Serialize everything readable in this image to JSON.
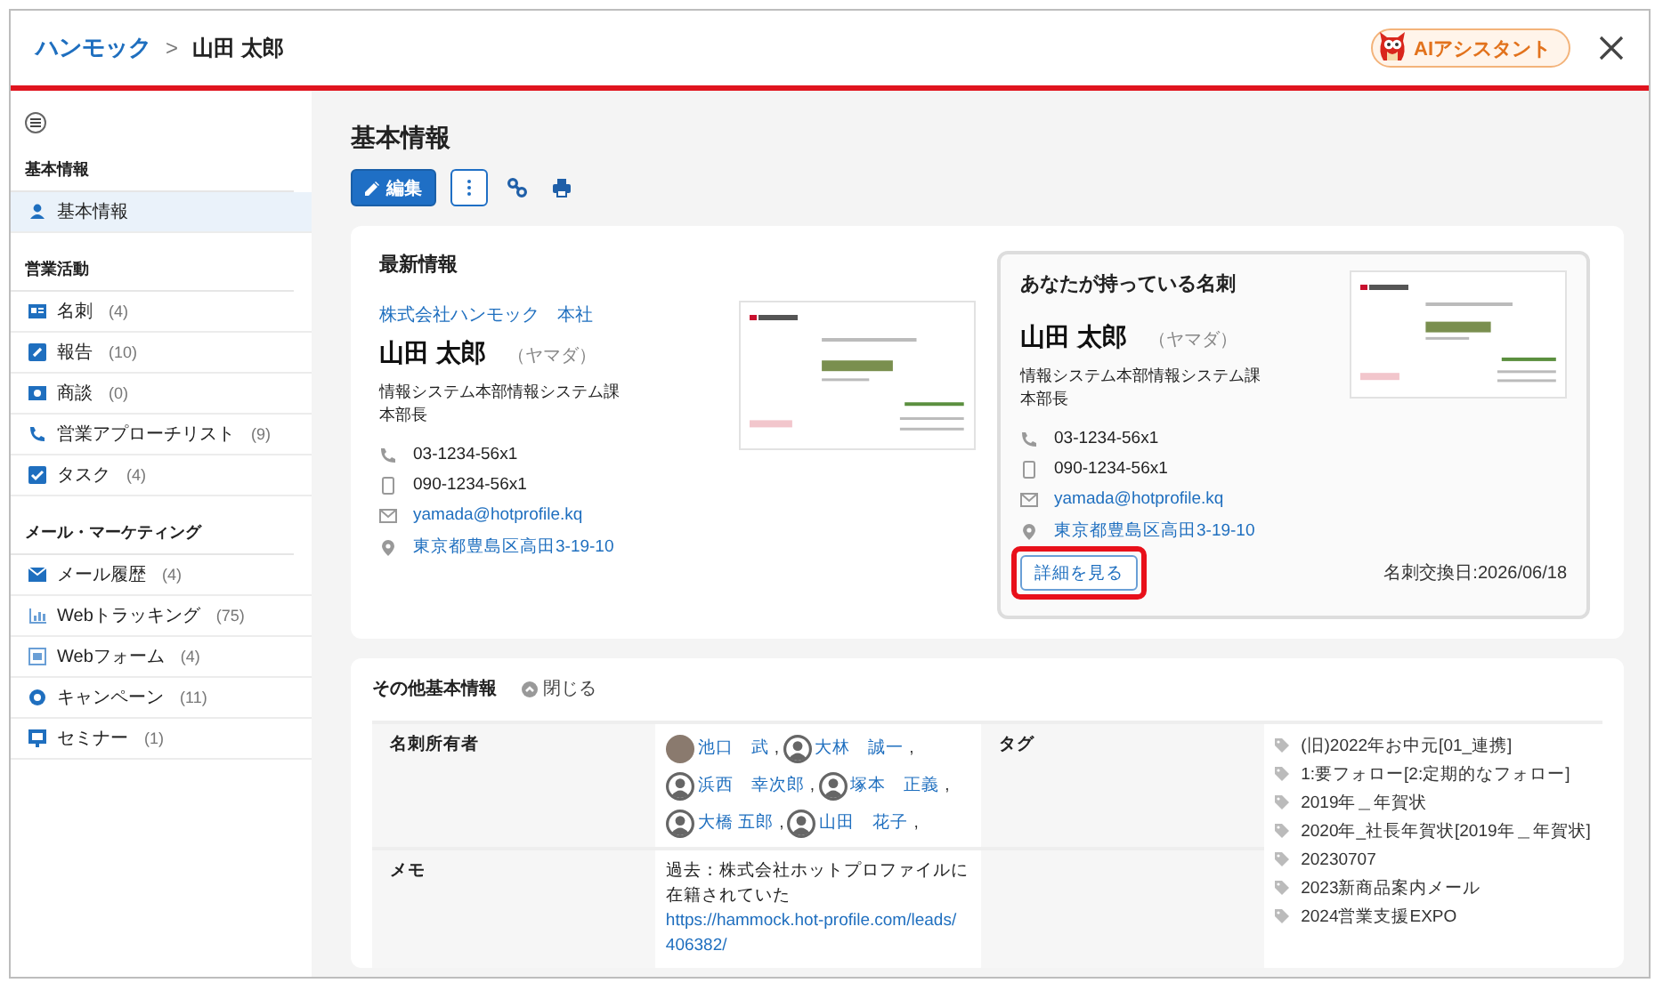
{
  "header": {
    "breadcrumb_parent": "ハンモック",
    "breadcrumb_separator": ">",
    "breadcrumb_current": "山田 太郎",
    "assistant_button": "AIアシスタント"
  },
  "sidebar": {
    "sections": [
      {
        "title": "基本情報",
        "items": [
          {
            "label": "基本情報",
            "selected": true
          }
        ]
      },
      {
        "title": "営業活動",
        "items": [
          {
            "label": "名刺",
            "count": "(4)",
            "selected": false
          },
          {
            "label": "報告",
            "count": "(10)",
            "selected": false
          },
          {
            "label": "商談",
            "count": "(0)",
            "selected": false
          },
          {
            "label": "営業アプローチリスト",
            "count": "(9)",
            "selected": false
          },
          {
            "label": "タスク",
            "count": "(4)",
            "selected": false
          }
        ]
      },
      {
        "title": "メール・マーケティング",
        "items": [
          {
            "label": "メール履歴",
            "count": "(4)",
            "selected": false
          },
          {
            "label": "Webトラッキング",
            "count": "(75)",
            "selected": false
          },
          {
            "label": "Webフォーム",
            "count": "(4)",
            "selected": false
          },
          {
            "label": "キャンペーン",
            "count": "(11)",
            "selected": false
          },
          {
            "label": "セミナー",
            "count": "(1)",
            "selected": false
          }
        ]
      }
    ]
  },
  "page_title": "基本情報",
  "toolbar": {
    "edit_button": "編集"
  },
  "latest": {
    "title": "最新情報",
    "company": "株式会社ハンモック　本社",
    "name": "山田 太郎",
    "reading": "（ヤマダ）",
    "department": "情報システム本部情報システム課",
    "position": "本部長",
    "phone": "03-1234-56x1",
    "mobile": "090-1234-56x1",
    "email": "yamada@hotprofile.kq",
    "address": "東京都豊島区高田3-19-10"
  },
  "owned_card": {
    "title": "あなたが持っている名刺",
    "name": "山田 太郎",
    "reading": "（ヤマダ）",
    "department": "情報システム本部情報システム課",
    "position": "本部長",
    "phone": "03-1234-56x1",
    "mobile": "090-1234-56x1",
    "email": "yamada@hotprofile.kq",
    "address": "東京都豊島区高田3-19-10",
    "details_button": "詳細を見る",
    "details_highlighted": true,
    "exchange_date": "名刺交換日:2026/06/18"
  },
  "other_info": {
    "title": "その他基本情報",
    "toggle": "閉じる",
    "owners_label": "名刺所有者",
    "owners": [
      {
        "name": "池口　武",
        "kind": "photo",
        "separator": ","
      },
      {
        "name": "大林　誠一",
        "kind": "generic",
        "separator": ","
      },
      {
        "name": "浜西　幸次郎",
        "kind": "generic",
        "separator": ","
      },
      {
        "name": "塚本　正義",
        "kind": "generic",
        "separator": ","
      },
      {
        "name": "大橋 五郎",
        "kind": "generic",
        "separator": ","
      },
      {
        "name": "山田　花子",
        "kind": "generic",
        "separator": ","
      }
    ],
    "memo_label": "メモ",
    "memo_text": "過去：株式会社ホットプロファイルに在籍されていた",
    "memo_link": "https://hammock.hot-profile.com/leads/406382/",
    "tags_label": "タグ",
    "tags": [
      "(旧)2022年お中元[01_連携]",
      "1:要フォロー[2:定期的なフォロー]",
      "2019年＿年賀状",
      "2020年_社長年賀状[2019年＿年賀状]",
      "20230707",
      "2023新商品案内メール",
      "2024営業支援EXPO"
    ]
  }
}
